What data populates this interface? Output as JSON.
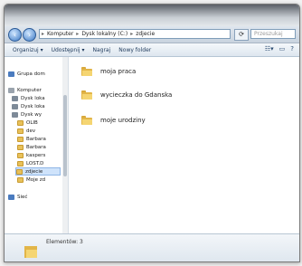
{
  "window": {
    "title": "",
    "address": {
      "crumbs": [
        "Komputer",
        "Dysk lokalny (C:)",
        "zdjecie"
      ],
      "search_placeholder": "Przeszukaj"
    },
    "toolbar": {
      "items": [
        "Organizuj ▾",
        "Udostępnij ▾",
        "Nagraj",
        "Nowy folder"
      ]
    },
    "nav": {
      "items": [
        {
          "label": "Grupa dom",
          "icon": "homegroup-icon"
        },
        {
          "label": "Komputer",
          "icon": "computer-icon"
        },
        {
          "label": "Dysk loka",
          "icon": "drive-icon"
        },
        {
          "label": "Dysk loka",
          "icon": "drive-icon"
        },
        {
          "label": "Dysk wy",
          "icon": "drive-icon"
        },
        {
          "label": "OLIB",
          "icon": "folder-icon"
        },
        {
          "label": "dev",
          "icon": "folder-icon"
        },
        {
          "label": "Barbara",
          "icon": "folder-icon"
        },
        {
          "label": "Barbara",
          "icon": "folder-icon"
        },
        {
          "label": "kaspers",
          "icon": "folder-icon"
        },
        {
          "label": "LOST.D",
          "icon": "folder-icon"
        },
        {
          "label": "zdjecie",
          "icon": "folder-icon"
        },
        {
          "label": "Moje zd",
          "icon": "folder-icon"
        },
        {
          "label": "Sieć",
          "icon": "network-icon"
        }
      ]
    },
    "files": [
      {
        "name": "moja praca"
      },
      {
        "name": "wycieczka do Gdanska"
      },
      {
        "name": "moje urodziny"
      }
    ],
    "status": {
      "text": "Elementów: 3"
    }
  }
}
